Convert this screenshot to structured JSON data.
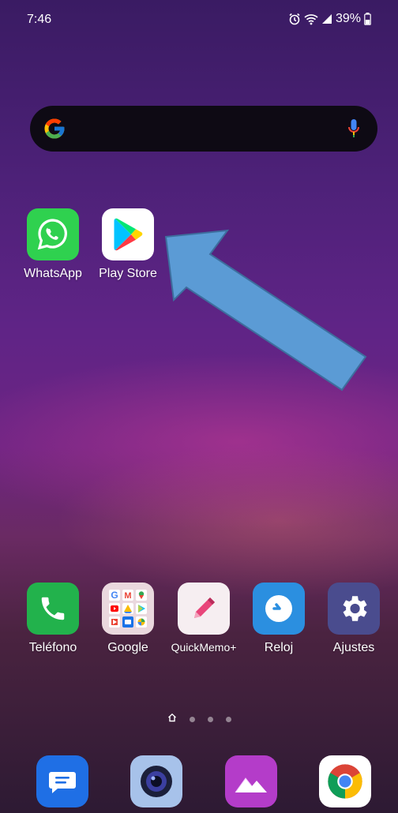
{
  "status_bar": {
    "time": "7:46",
    "battery": "39%",
    "icons": [
      "alarm-icon",
      "wifi-icon",
      "signal-icon",
      "battery-icon"
    ]
  },
  "search": {
    "logo": "google-g-icon",
    "mic": "mic-icon"
  },
  "home_apps": [
    {
      "label": "WhatsApp",
      "icon": "whatsapp-icon",
      "color": "#2fd14f"
    },
    {
      "label": "Play Store",
      "icon": "play-store-icon",
      "color": "#ffffff"
    }
  ],
  "row_apps": [
    {
      "label": "Teléfono",
      "icon": "phone-icon",
      "color": "#22b24c"
    },
    {
      "label": "Google",
      "icon": "google-folder-icon",
      "color": "#ead8de"
    },
    {
      "label": "QuickMemo+",
      "icon": "pen-icon",
      "color": "#f6eef1"
    },
    {
      "label": "Reloj",
      "icon": "clock-icon",
      "color": "#2b8fe0"
    },
    {
      "label": "Ajustes",
      "icon": "gear-icon",
      "color": "#4a4c8e"
    }
  ],
  "dock": [
    {
      "icon": "messages-icon",
      "color": "#1f6fe5"
    },
    {
      "icon": "camera-icon",
      "color": "#a7c2ea"
    },
    {
      "icon": "gallery-icon",
      "color": "#b43cc9"
    },
    {
      "icon": "chrome-icon",
      "color": "#ffffff"
    }
  ],
  "annotation": {
    "arrow_color": "#5b9bd5",
    "points_to": "Play Store"
  },
  "pager": {
    "pages": 4,
    "current": "home"
  }
}
